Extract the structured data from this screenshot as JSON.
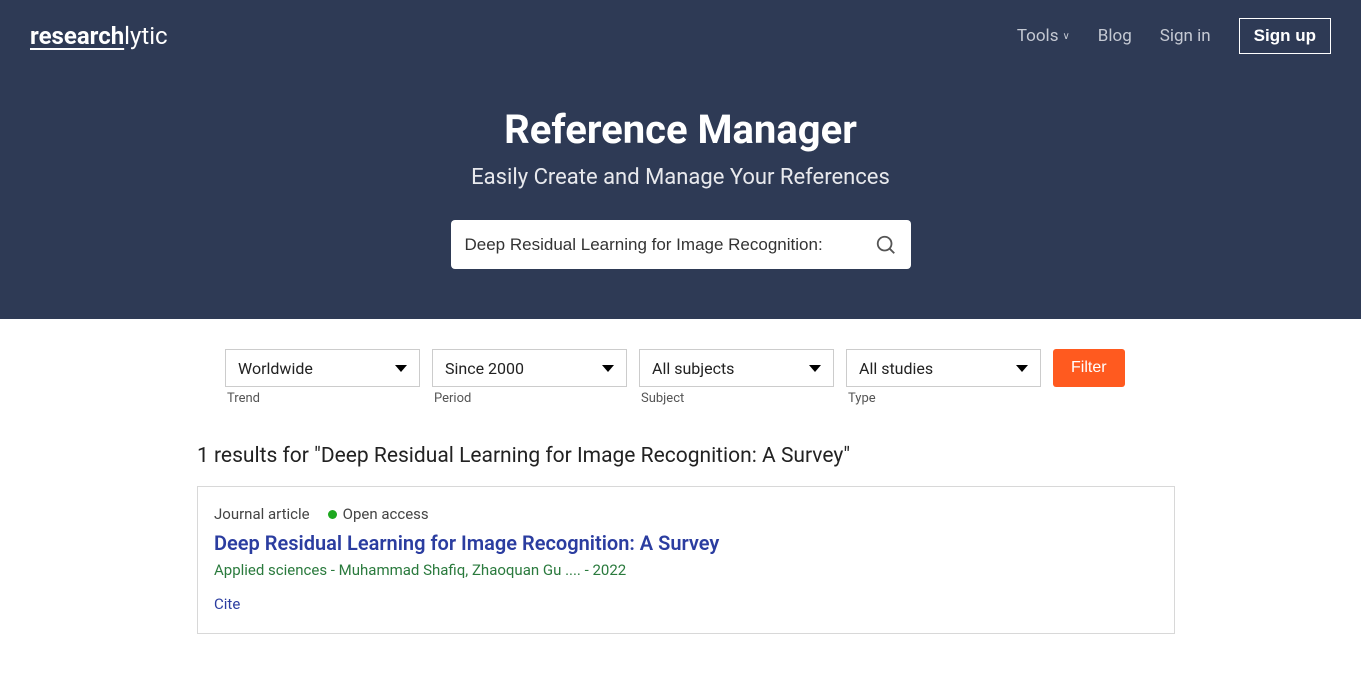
{
  "nav": {
    "logo_prefix": "research",
    "logo_suffix": "lytic",
    "tools": "Tools",
    "blog": "Blog",
    "signin": "Sign in",
    "signup": "Sign up"
  },
  "hero": {
    "title": "Reference Manager",
    "subtitle": "Easily Create and Manage Your References"
  },
  "search": {
    "value": "Deep Residual Learning for Image Recognition:"
  },
  "filters": {
    "trend": {
      "value": "Worldwide",
      "label": "Trend"
    },
    "period": {
      "value": "Since 2000",
      "label": "Period"
    },
    "subject": {
      "value": "All subjects",
      "label": "Subject"
    },
    "type": {
      "value": "All studies",
      "label": "Type"
    },
    "button": "Filter"
  },
  "results": {
    "heading": "1 results for \"Deep Residual Learning for Image Recognition: A Survey\"",
    "items": [
      {
        "type": "Journal article",
        "access": "Open access",
        "title": "Deep Residual Learning for Image Recognition: A Survey",
        "authors": "Applied sciences - Muhammad Shafiq, Zhaoquan Gu .... - 2022",
        "cite": "Cite"
      }
    ]
  }
}
